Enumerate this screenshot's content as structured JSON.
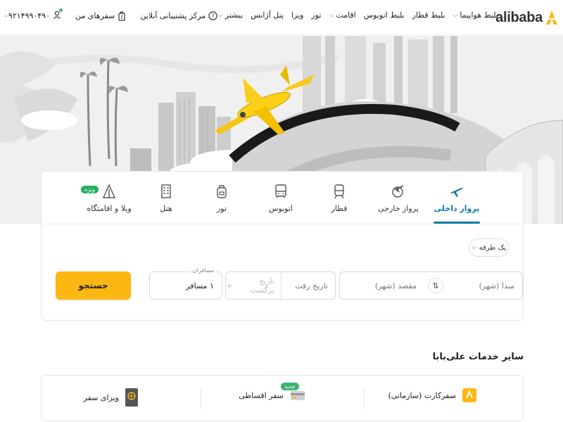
{
  "header": {
    "logo_text": "alibaba",
    "nav": [
      {
        "label": "بلیط هواپیما",
        "dropdown": true
      },
      {
        "label": "بلیط قطار",
        "dropdown": false
      },
      {
        "label": "بلیط اتوبوس",
        "dropdown": false
      },
      {
        "label": "اقامت",
        "dropdown": true
      },
      {
        "label": "تور",
        "dropdown": false
      },
      {
        "label": "ویزا",
        "dropdown": false
      },
      {
        "label": "پنل آژانس",
        "dropdown": false
      },
      {
        "label": "بیشتر",
        "dropdown": true
      }
    ],
    "support_label": "مرکز پشتیبانی آنلاین",
    "trips_label": "سفرهای من",
    "phone": "۰۹۲۱۴۹۹۰۴۹۰"
  },
  "tabs": [
    {
      "label": "پرواز داخلی",
      "icon": "plane-icon",
      "active": true
    },
    {
      "label": "پرواز خارجی",
      "icon": "globe-plane-icon",
      "active": false
    },
    {
      "label": "قطار",
      "icon": "train-icon",
      "active": false
    },
    {
      "label": "اتوبوس",
      "icon": "bus-icon",
      "active": false
    },
    {
      "label": "تور",
      "icon": "backpack-icon",
      "active": false
    },
    {
      "label": "هتل",
      "icon": "hotel-icon",
      "active": false
    },
    {
      "label": "ویلا و اقامتگاه",
      "icon": "villa-icon",
      "active": false,
      "badge": "ویژه"
    }
  ],
  "search": {
    "trip_type": "یک طرفه",
    "origin_placeholder": "مبدا (شهر)",
    "destination_placeholder": "مقصد (شهر)",
    "depart_placeholder": "تاریخ رفت",
    "return_placeholder": "تاریخ برگشت",
    "passengers_label": "مسافران",
    "passengers_value": "۱ مسافر",
    "search_button": "جستجو"
  },
  "services": {
    "title": "سایر خدمات علی‌بابا",
    "items": [
      {
        "label": "سفرکارت (سازمانی)",
        "icon": "card-icon"
      },
      {
        "label": "سفر اقساطی",
        "icon": "installment-icon",
        "badge": "جدید"
      },
      {
        "label": "ویزای سفر",
        "icon": "passport-icon"
      }
    ]
  },
  "colors": {
    "accent_blue": "#0a7aaa",
    "brand_yellow": "#fdb713",
    "green": "#27ae60"
  }
}
